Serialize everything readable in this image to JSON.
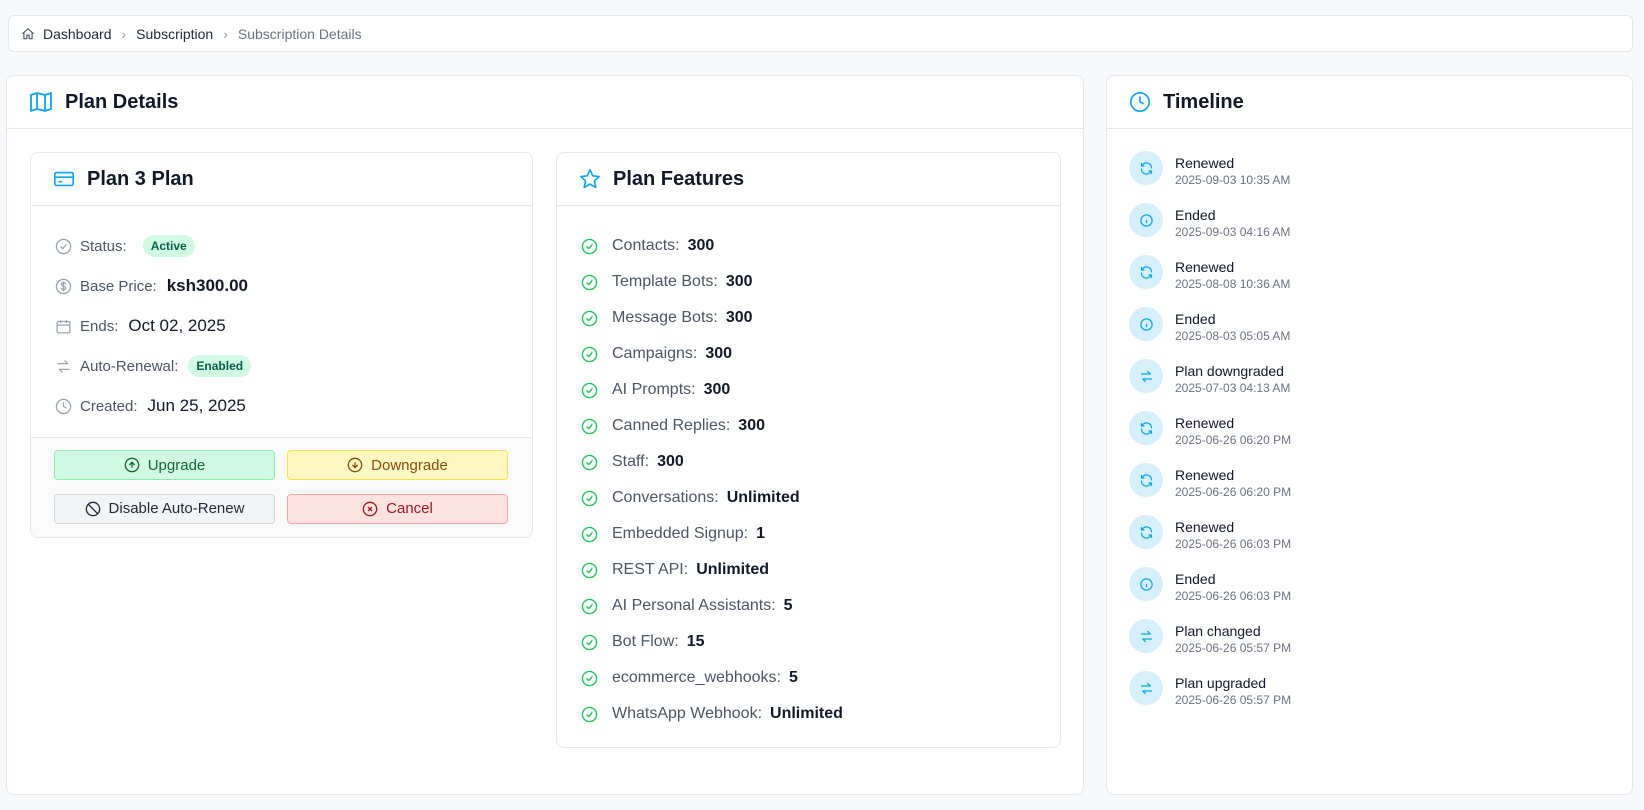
{
  "breadcrumb": {
    "items": [
      "Dashboard",
      "Subscription",
      "Subscription Details"
    ]
  },
  "plan_details": {
    "title": "Plan Details",
    "plan": {
      "title": "Plan 3 Plan",
      "status_label": "Status:",
      "status_value": "Active",
      "base_price_label": "Base Price:",
      "base_price_value": "ksh300.00",
      "ends_label": "Ends:",
      "ends_value": "Oct 02, 2025",
      "auto_renewal_label": "Auto-Renewal:",
      "auto_renewal_value": "Enabled",
      "created_label": "Created:",
      "created_value": "Jun 25, 2025"
    },
    "actions": {
      "upgrade": "Upgrade",
      "downgrade": "Downgrade",
      "disable_auto_renew": "Disable Auto-Renew",
      "cancel": "Cancel"
    },
    "features": {
      "title": "Plan Features",
      "items": [
        {
          "label": "Contacts:",
          "value": "300"
        },
        {
          "label": "Template Bots:",
          "value": "300"
        },
        {
          "label": "Message Bots:",
          "value": "300"
        },
        {
          "label": "Campaigns:",
          "value": "300"
        },
        {
          "label": "AI Prompts:",
          "value": "300"
        },
        {
          "label": "Canned Replies:",
          "value": "300"
        },
        {
          "label": "Staff:",
          "value": "300"
        },
        {
          "label": "Conversations:",
          "value": "Unlimited"
        },
        {
          "label": "Embedded Signup:",
          "value": "1"
        },
        {
          "label": "REST API:",
          "value": "Unlimited"
        },
        {
          "label": "AI Personal Assistants:",
          "value": "5"
        },
        {
          "label": "Bot Flow:",
          "value": "15"
        },
        {
          "label": "ecommerce_webhooks:",
          "value": "5"
        },
        {
          "label": "WhatsApp Webhook:",
          "value": "Unlimited"
        }
      ]
    }
  },
  "timeline": {
    "title": "Timeline",
    "items": [
      {
        "event": "Renewed",
        "time": "2025-09-03 10:35 AM",
        "icon": "refresh-icon"
      },
      {
        "event": "Ended",
        "time": "2025-09-03 04:16 AM",
        "icon": "info-icon"
      },
      {
        "event": "Renewed",
        "time": "2025-08-08 10:36 AM",
        "icon": "refresh-icon"
      },
      {
        "event": "Ended",
        "time": "2025-08-03 05:05 AM",
        "icon": "info-icon"
      },
      {
        "event": "Plan downgraded",
        "time": "2025-07-03 04:13 AM",
        "icon": "swap-icon"
      },
      {
        "event": "Renewed",
        "time": "2025-06-26 06:20 PM",
        "icon": "refresh-icon"
      },
      {
        "event": "Renewed",
        "time": "2025-06-26 06:20 PM",
        "icon": "refresh-icon"
      },
      {
        "event": "Renewed",
        "time": "2025-06-26 06:03 PM",
        "icon": "refresh-icon"
      },
      {
        "event": "Ended",
        "time": "2025-06-26 06:03 PM",
        "icon": "info-icon"
      },
      {
        "event": "Plan changed",
        "time": "2025-06-26 05:57 PM",
        "icon": "swap-icon"
      },
      {
        "event": "Plan upgraded",
        "time": "2025-06-26 05:57 PM",
        "icon": "swap-icon"
      }
    ]
  },
  "colors": {
    "accent": "#0ea5e9",
    "success": "#22c55e",
    "badge_bg": "#d1fae5"
  }
}
